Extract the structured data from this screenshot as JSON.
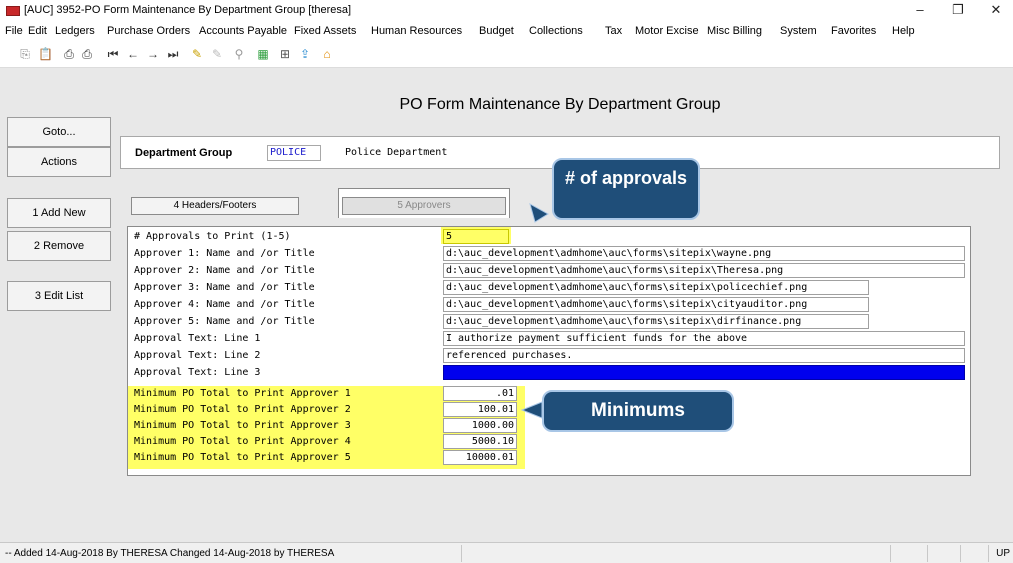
{
  "window": {
    "title": "[AUC] 3952-PO Form Maintenance By Department Group [theresa]",
    "minimize": "–",
    "restore": "❐",
    "close": "✕"
  },
  "menu": [
    "File",
    "Edit",
    "Ledgers",
    "Purchase Orders",
    "Accounts Payable",
    "Fixed Assets",
    "Human Resources",
    "Budget",
    "Collections",
    "Tax",
    "Motor Excise",
    "Misc Billing",
    "System",
    "Favorites",
    "Help"
  ],
  "toolbar": {
    "icons": [
      "copy-icon",
      "paste-icon",
      "print-icon",
      "print-preview-icon",
      "first-record-icon",
      "previous-record-icon",
      "next-record-icon",
      "last-record-icon",
      "edit-icon",
      "edit-disabled-icon",
      "search-icon",
      "spreadsheet-icon",
      "properties-icon",
      "export-icon",
      "home-icon"
    ]
  },
  "sidebar": {
    "goto": "Goto...",
    "actions": "Actions",
    "add_new": "1 Add New",
    "remove": "2 Remove",
    "edit_list": "3 Edit List"
  },
  "page_title": "PO Form Maintenance By Department Group",
  "department": {
    "label": "Department Group",
    "code": "POLICE",
    "name": "Police Department"
  },
  "tabs": {
    "headers_footers": "4 Headers/Footers",
    "approvers": "5 Approvers"
  },
  "form": {
    "rows": [
      {
        "label": "# Approvals to Print (1-5)",
        "value": "5"
      },
      {
        "label": "Approver 1: Name and /or Title",
        "value": "d:\\auc_development\\admhome\\auc\\forms\\sitepix\\wayne.png"
      },
      {
        "label": "Approver 2: Name and /or Title",
        "value": "d:\\auc_development\\admhome\\auc\\forms\\sitepix\\Theresa.png"
      },
      {
        "label": "Approver 3: Name and /or Title",
        "value": "d:\\auc_development\\admhome\\auc\\forms\\sitepix\\policechief.png"
      },
      {
        "label": "Approver 4: Name and /or Title",
        "value": "d:\\auc_development\\admhome\\auc\\forms\\sitepix\\cityauditor.png"
      },
      {
        "label": "Approver 5: Name and /or Title",
        "value": "d:\\auc_development\\admhome\\auc\\forms\\sitepix\\dirfinance.png"
      },
      {
        "label": "Approval Text: Line 1",
        "value": "I authorize payment sufficient funds for the above"
      },
      {
        "label": "Approval Text: Line 2",
        "value": "referenced purchases."
      },
      {
        "label": "Approval Text: Line 3",
        "value": ""
      },
      {
        "label": "Minimum PO Total to Print Approver 1",
        "value": ".01"
      },
      {
        "label": "Minimum PO Total to Print Approver 2",
        "value": "100.01"
      },
      {
        "label": "Minimum PO Total to Print Approver 3",
        "value": "1000.00"
      },
      {
        "label": "Minimum PO Total to Print Approver 4",
        "value": "5000.10"
      },
      {
        "label": "Minimum PO Total to Print Approver 5",
        "value": "10000.01"
      }
    ]
  },
  "callouts": {
    "approvals": "# of approvals",
    "minimums": "Minimums"
  },
  "status": {
    "text": "-- Added 14-Aug-2018 By THERESA Changed 14-Aug-2018 by THERESA",
    "mode": "UP"
  },
  "colors": {
    "highlight": "#ffff66",
    "callout_fill": "#1f4e79",
    "active_field": "#0000ee"
  }
}
